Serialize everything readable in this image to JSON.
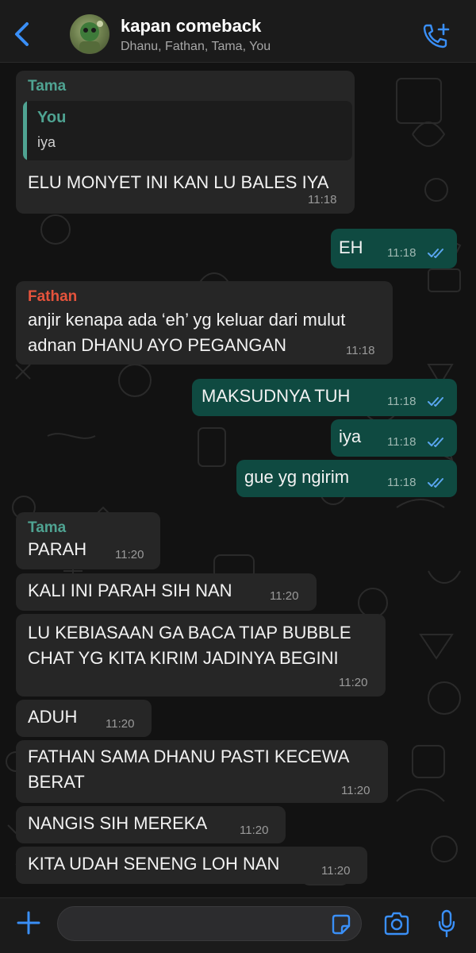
{
  "header": {
    "title": "kapan comeback",
    "members": "Dhanu, Fathan, Tama, You"
  },
  "colors": {
    "header_bg": "#1b1b1b",
    "incoming_bubble": "#262626",
    "outgoing_bubble": "#0f4a41",
    "accent_blue": "#3a8ff7",
    "tama_name": "#4fa392",
    "fathan_name": "#e5533c",
    "read_ticks": "#5aa6f0"
  },
  "icons": {
    "back": "chevron-left-icon",
    "call": "phone-plus-icon",
    "plus": "plus-icon",
    "sticker": "sticker-icon",
    "camera": "camera-icon",
    "mic": "microphone-icon",
    "ticks": "double-check-icon"
  },
  "messages": [
    {
      "sender": "Tama",
      "quote_sender": "You",
      "quote_text": "iya",
      "text": "ELU MONYET INI KAN LU BALES IYA",
      "time": "11:18"
    },
    {
      "text": "EH",
      "time": "11:18"
    },
    {
      "sender": "Fathan",
      "line1": "anjir kenapa ada ‘eh’ yg keluar dari mulut",
      "line2": "adnan DHANU AYO PEGANGAN",
      "time": "11:18"
    },
    {
      "text": "MAKSUDNYA TUH",
      "time": "11:18"
    },
    {
      "text": "iya",
      "time": "11:18"
    },
    {
      "text": "gue yg ngirim",
      "time": "11:18"
    },
    {
      "sender": "Tama",
      "text": "PARAH",
      "time": "11:20"
    },
    {
      "text": "KALI INI PARAH SIH NAN",
      "time": "11:20"
    },
    {
      "line1": "LU KEBIASAAN GA BACA TIAP BUBBLE",
      "line2": "CHAT YG KITA KIRIM JADINYA BEGINI",
      "time": "11:20"
    },
    {
      "text": "ADUH",
      "time": "11:20"
    },
    {
      "line1": "FATHAN SAMA DHANU PASTI KECEWA",
      "line2": "BERAT",
      "time": "11:20"
    },
    {
      "text": "NANGIS SIH MEREKA",
      "time": "11:20"
    },
    {
      "text": "KITA UDAH SENENG LOH NAN",
      "time": "11:20"
    }
  ],
  "input": {
    "value": "",
    "placeholder": ""
  }
}
